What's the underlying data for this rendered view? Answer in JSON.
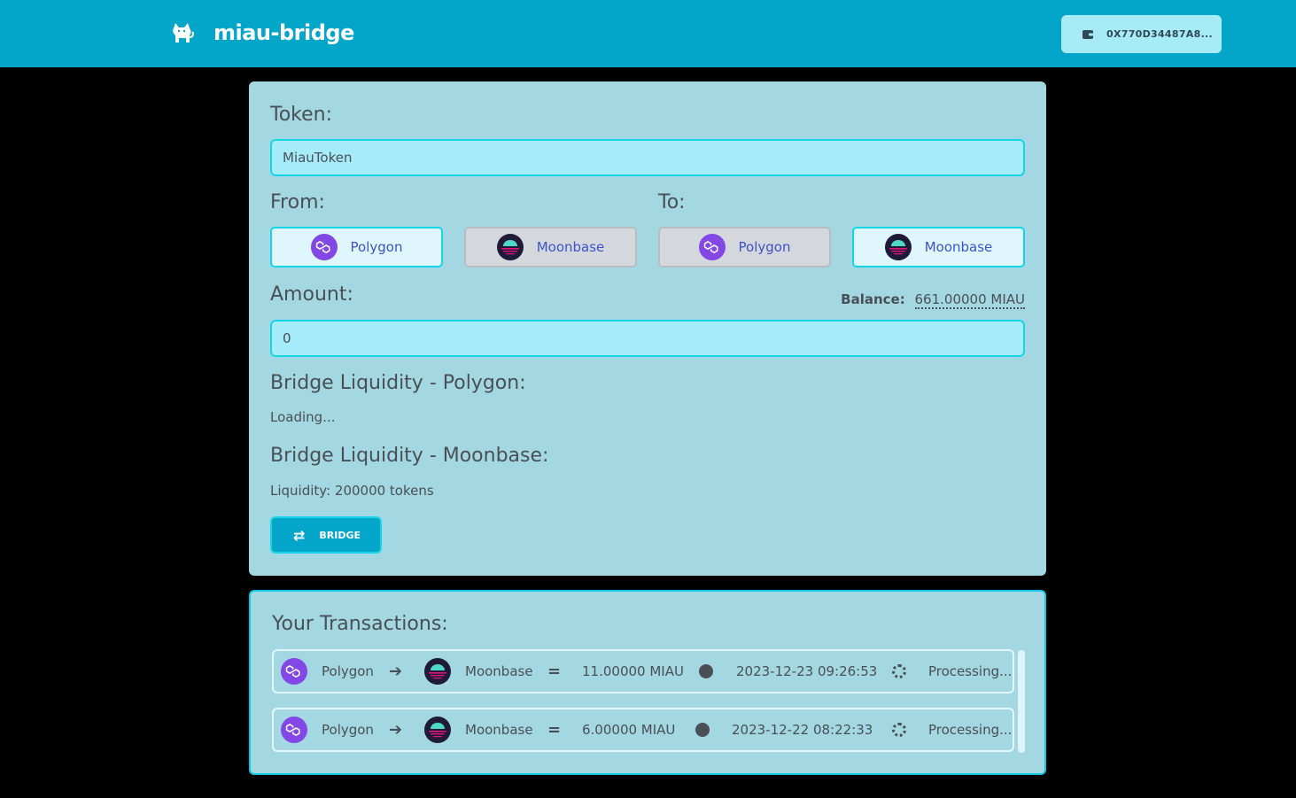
{
  "header": {
    "app_name": "miau-bridge",
    "wallet_address": "0X770D34487A8..."
  },
  "form": {
    "token_label": "Token:",
    "token_value": "MiauToken",
    "from_label": "From:",
    "to_label": "To:",
    "from_options": [
      {
        "label": "Polygon",
        "selected": true
      },
      {
        "label": "Moonbase",
        "selected": false
      }
    ],
    "to_options": [
      {
        "label": "Polygon",
        "selected": false
      },
      {
        "label": "Moonbase",
        "selected": true
      }
    ],
    "amount_label": "Amount:",
    "amount_value": "0",
    "balance_label": "Balance:",
    "balance_value": "661.00000 MIAU",
    "liquidity_polygon_title": "Bridge Liquidity - Polygon:",
    "liquidity_polygon_value": "Loading...",
    "liquidity_moonbase_title": "Bridge Liquidity - Moonbase:",
    "liquidity_moonbase_value": "Liquidity: 200000 tokens",
    "bridge_button": "BRIDGE"
  },
  "transactions": {
    "title": "Your Transactions:",
    "items": [
      {
        "from": "Polygon",
        "to": "Moonbase",
        "amount": "11.00000 MIAU",
        "timestamp": "2023-12-23 09:26:53",
        "status": "Processing..."
      },
      {
        "from": "Polygon",
        "to": "Moonbase",
        "amount": "6.00000 MIAU",
        "timestamp": "2023-12-22 08:22:33",
        "status": "Processing..."
      }
    ]
  },
  "colors": {
    "navbar": "#03a6c9",
    "card": "#a3d8e3",
    "input": "#a6ebfa",
    "accent_border": "#14d5ea",
    "chain_text": "#3d52c9",
    "polygon": "#8247e5",
    "moonbase_dark": "#1f1a38",
    "moonbase_teal": "#4fd8c7"
  },
  "icons": [
    "cat-logo-icon",
    "wallet-icon",
    "polygon-icon",
    "moonbase-icon",
    "swap-icon",
    "arrow-right-icon",
    "equals-icon",
    "clock-icon",
    "spinner-icon"
  ]
}
